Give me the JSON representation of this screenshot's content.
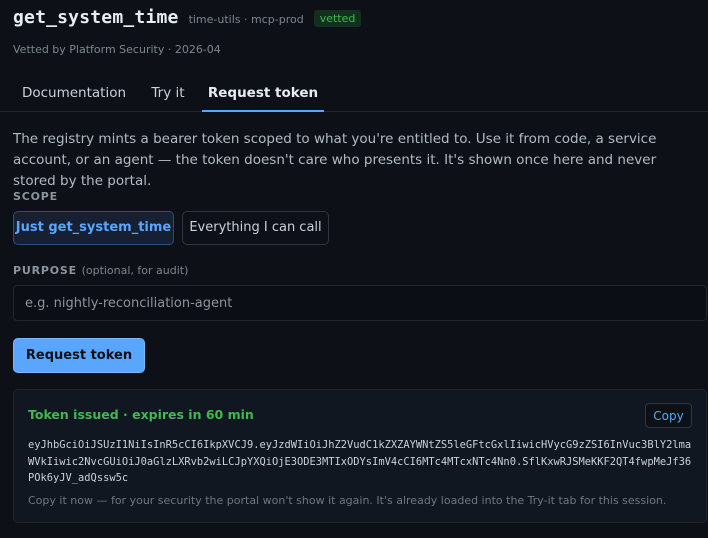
{
  "header": {
    "tool_name": "get_system_time",
    "meta": "time-utils · mcp-prod",
    "badge": "vetted",
    "vetted_by": "Vetted by Platform Security · 2026-04"
  },
  "tabs": [
    {
      "label": "Documentation",
      "active": false
    },
    {
      "label": "Try it",
      "active": false
    },
    {
      "label": "Request token",
      "active": true
    }
  ],
  "description": "The registry mints a bearer token scoped to what you're entitled to. Use it from code, a service account, or an agent — the token doesn't care who presents it. It's shown once here and never stored by the portal.",
  "scope": {
    "label": "SCOPE",
    "options": [
      {
        "label": "Just get_system_time",
        "selected": true
      },
      {
        "label": "Everything I can call",
        "selected": false
      }
    ]
  },
  "purpose": {
    "label": "PURPOSE",
    "sublabel": "(optional, for audit)",
    "value": "",
    "placeholder": "e.g. nightly-reconciliation-agent"
  },
  "request_button": "Request token",
  "token": {
    "status": "Token issued · expires in 60 min",
    "copy_label": "Copy",
    "value": "eyJhbGciOiJSUzI1NiIsInR5cCI6IkpXVCJ9.eyJzdWIiOiJhZ2VudC1kZXZAYWNtZS5leGFtcGxlIiwicHVycG9zZSI6InVuc3BlY2lmaWVkIiwic2NvcGUiOiJ0aGlzLXRvb2wiLCJpYXQiOjE3ODE3MTIxODYsImV4cCI6MTc4MTcxNTc4Nn0.SflKxwRJSMeKKF2QT4fwpMeJf36POk6yJV_adQssw5c",
    "note": "Copy it now — for your security the portal won't show it again. It's already loaded into the Try-it tab for this session."
  },
  "colors": {
    "background": "#0d1117",
    "accent": "#58a6ff",
    "success": "#3fb950"
  }
}
